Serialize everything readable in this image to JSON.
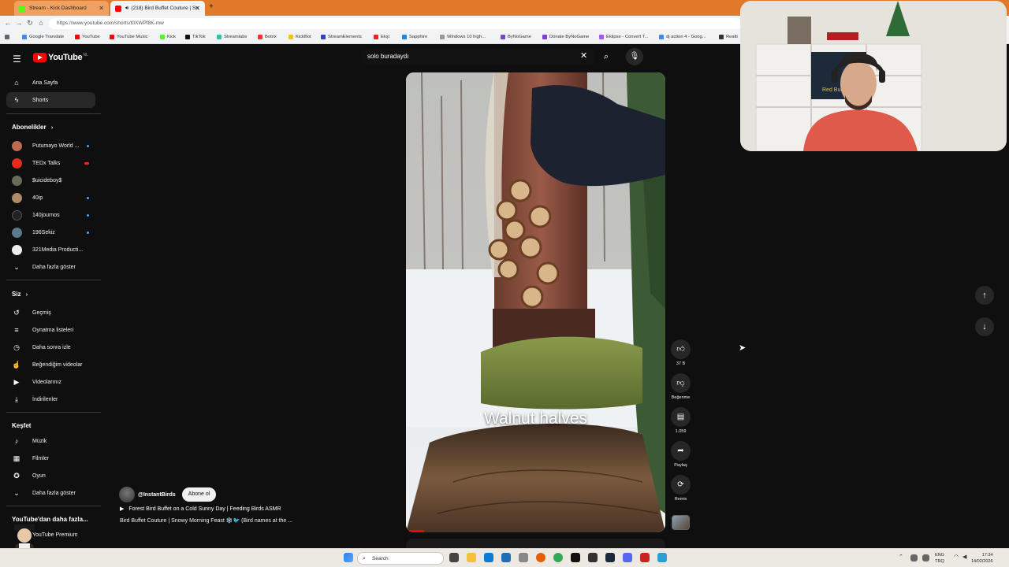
{
  "browser": {
    "tabs": [
      {
        "title": "Stream - Kick Dashboard",
        "color": "#53fc18"
      },
      {
        "title": "(218) Bird Buffet Couture | Sn",
        "color": "#ff0000"
      }
    ],
    "url": "https://www.youtube.com/shorts/t0XWPf8K-mw",
    "bookmarks": [
      {
        "label": "Google Translate",
        "color": "#4285f4"
      },
      {
        "label": "YouTube",
        "color": "#ff0000"
      },
      {
        "label": "YouTube Music",
        "color": "#ff0000"
      },
      {
        "label": "Kick",
        "color": "#53fc18"
      },
      {
        "label": "TikTok",
        "color": "#111111"
      },
      {
        "label": "Streamlabs",
        "color": "#31c3a2"
      },
      {
        "label": "Botrix",
        "color": "#e33"
      },
      {
        "label": "KickBot",
        "color": "#f5c400"
      },
      {
        "label": "StreamElements",
        "color": "#3344bb"
      },
      {
        "label": "Ekşi",
        "color": "#e22"
      },
      {
        "label": "Sapphire",
        "color": "#2288dd"
      },
      {
        "label": "Windows 10 high...",
        "color": "#999999"
      },
      {
        "label": "ByNoGame",
        "color": "#7744cc"
      },
      {
        "label": "Donate ByNoGame",
        "color": "#7744cc"
      },
      {
        "label": "Eklipse - Convert T...",
        "color": "#aa55ff"
      },
      {
        "label": "dj action 4 - Goog...",
        "color": "#4285f4"
      },
      {
        "label": "Realti",
        "color": "#333333"
      }
    ]
  },
  "youtube": {
    "logo_text": "YouTube",
    "region": "NL",
    "search_value": "solo buradaydı",
    "sidebar": {
      "main": [
        {
          "label": "Ana Sayfa",
          "icon": "home-icon",
          "glyph": "⌂"
        },
        {
          "label": "Shorts",
          "icon": "shorts-icon",
          "glyph": "ϟ"
        }
      ],
      "subscriptions_title": "Abonelikler",
      "subscriptions": [
        {
          "label": "Putumayo World ...",
          "color": "#c06a52"
        },
        {
          "label": "TEDx Talks",
          "color": "#e62b1e"
        },
        {
          "label": "$uicideboy$",
          "color": "#6b6b5a"
        },
        {
          "label": "40ip",
          "color": "#b08a66"
        },
        {
          "label": "140journos",
          "color": "#222222"
        },
        {
          "label": "196Sekiz",
          "color": "#5a7a8a"
        },
        {
          "label": "321Media Producti...",
          "color": "#eeeeee"
        }
      ],
      "show_more": "Daha fazla göster",
      "you_title": "Siz",
      "you_items": [
        {
          "label": "Geçmiş",
          "icon": "history-icon",
          "glyph": "↺"
        },
        {
          "label": "Oynatma listeleri",
          "icon": "playlist-icon",
          "glyph": "≡"
        },
        {
          "label": "Daha sonra izle",
          "icon": "watch-later-icon",
          "glyph": "◷"
        },
        {
          "label": "Beğendiğim videolar",
          "icon": "like-icon",
          "glyph": "☝"
        },
        {
          "label": "Videolarınız",
          "icon": "your-videos-icon",
          "glyph": "▶"
        },
        {
          "label": "İndirilenler",
          "icon": "download-icon",
          "glyph": "⤓"
        }
      ],
      "explore_title": "Keşfet",
      "explore_items": [
        {
          "label": "Müzik",
          "icon": "music-icon",
          "glyph": "♪"
        },
        {
          "label": "Filmler",
          "icon": "film-icon",
          "glyph": "▦"
        },
        {
          "label": "Oyun",
          "icon": "gaming-icon",
          "glyph": "✪"
        }
      ],
      "show_more_2": "Daha fazla göster",
      "more_title": "YouTube'dan daha fazla...",
      "premium": "YouTube Premium"
    },
    "short": {
      "caption": "Walnut halves",
      "channel": "@InstantBirds",
      "subscribe": "Abone ol",
      "title": "Forest Bird Buffet on a Cold Sunny Day | Feeding Birds ASMR",
      "description": "Bird Buffet Couture | Snowy Morning Feast ❄️🐦 (Bird names at the ...",
      "progress": 0.07,
      "actions": {
        "like_count": "37 B",
        "dislike": "Beğenme",
        "comments": "1.059",
        "share": "Paylaş",
        "remix": "Remix"
      }
    }
  },
  "taskbar": {
    "search": "Search",
    "lang_1": "ENG",
    "lang_2": "TRQ",
    "time": "17:34",
    "date": "14/02/2026"
  }
}
